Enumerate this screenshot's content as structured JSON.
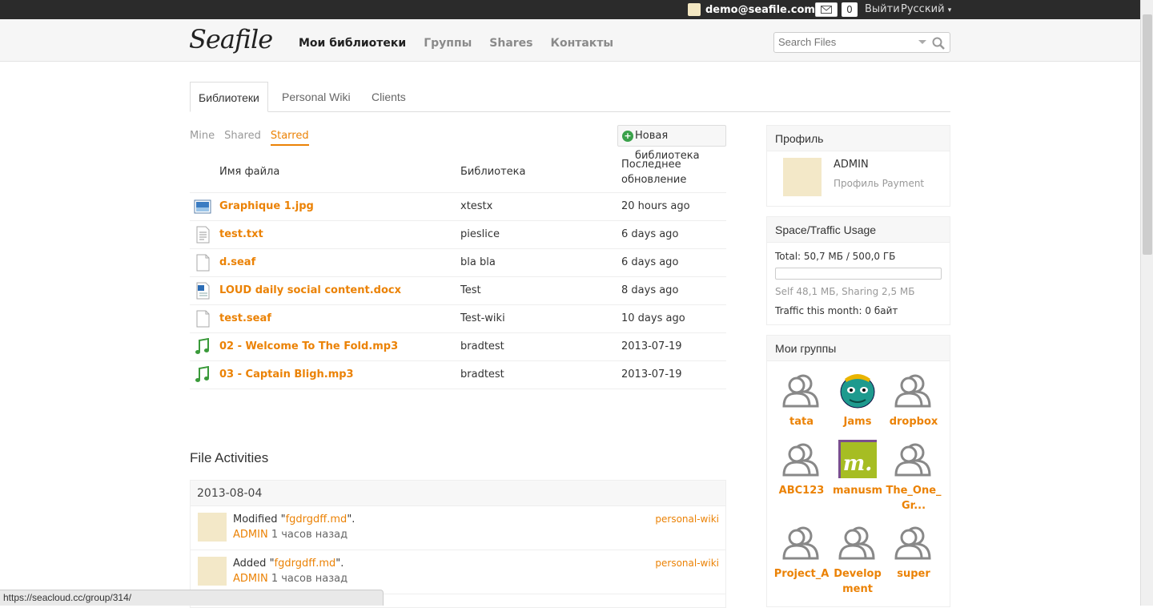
{
  "topbar": {
    "user": "demo@seafile.com",
    "msg_count": "0",
    "logout": "Выйти",
    "language": "Русский"
  },
  "header": {
    "logo": "Seafile",
    "nav": [
      "Мои библиотеки",
      "Группы",
      "Shares",
      "Контакты"
    ],
    "search_placeholder": "Search Files"
  },
  "tabs": [
    "Библиотеки",
    "Personal Wiki",
    "Clients"
  ],
  "subtabs": [
    "Mine",
    "Shared",
    "Starred"
  ],
  "new_library": "Новая библиотека",
  "files": {
    "headers": {
      "name": "Имя файла",
      "library": "Библиотека",
      "updated_1": "Последнее",
      "updated_2": "обновление"
    },
    "rows": [
      {
        "icon": "image-file-icon",
        "name": "Graphique 1.jpg",
        "library": "xtestx",
        "updated": "20 hours ago"
      },
      {
        "icon": "text-file-icon",
        "name": "test.txt",
        "library": "pieslice",
        "updated": "6 days ago"
      },
      {
        "icon": "generic-file-icon",
        "name": "d.seaf",
        "library": "bla bla",
        "updated": "6 days ago"
      },
      {
        "icon": "document-file-icon",
        "name": "LOUD daily social content.docx",
        "library": "Test",
        "updated": "8 days ago"
      },
      {
        "icon": "generic-file-icon",
        "name": "test.seaf",
        "library": "Test-wiki",
        "updated": "10 days ago"
      },
      {
        "icon": "music-file-icon",
        "name": "02 - Welcome To The Fold.mp3",
        "library": "bradtest",
        "updated": "2013-07-19"
      },
      {
        "icon": "music-file-icon",
        "name": "03 - Captain Bligh.mp3",
        "library": "bradtest",
        "updated": "2013-07-19"
      }
    ]
  },
  "activities": {
    "title": "File Activities",
    "date": "2013-08-04",
    "items": [
      {
        "action": "Modified ",
        "file": "fgdrgdff.md",
        "user": "ADMIN",
        "time": " 1 часов назад",
        "library": "personal-wiki"
      },
      {
        "action": "Added ",
        "file": "fgdrgdff.md",
        "user": "ADMIN",
        "time": " 1 часов назад",
        "library": "personal-wiki"
      }
    ]
  },
  "profile": {
    "title": "Профиль",
    "name": "ADMIN",
    "sub": "Профиль Payment"
  },
  "usage": {
    "title": "Space/Traffic Usage",
    "total": "Total: 50,7 МБ / 500,0 ГБ",
    "used_fraction": 0.0001,
    "detail": "Self 48,1 МБ, Sharing 2,5 МБ",
    "traffic": "Traffic this month: 0 байт"
  },
  "groups": {
    "title": "Мои группы",
    "items": [
      {
        "name": "tata",
        "icon": "default-group-icon"
      },
      {
        "name": "Jams",
        "icon": "green-face-icon"
      },
      {
        "name": "dropbox",
        "icon": "default-group-icon"
      },
      {
        "name": "ABC123",
        "icon": "default-group-icon"
      },
      {
        "name": "manusm",
        "icon": "m-logo-icon"
      },
      {
        "name": "The_One_Gr...",
        "icon": "default-group-icon"
      },
      {
        "name": "Project_A",
        "icon": "default-group-icon"
      },
      {
        "name": "Development",
        "icon": "default-group-icon"
      },
      {
        "name": "super",
        "icon": "default-group-icon"
      }
    ]
  },
  "status_url": "https://seacloud.cc/group/314/",
  "colors": {
    "accent": "#eb8205",
    "topbar": "#2b2b2b"
  }
}
